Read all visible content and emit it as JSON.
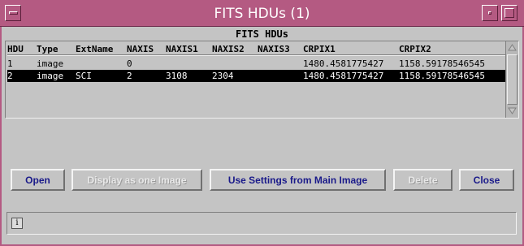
{
  "window": {
    "title": "FITS HDUs (1)"
  },
  "panel": {
    "title": "FITS HDUs"
  },
  "table": {
    "columns": [
      "HDU",
      "Type",
      "ExtName",
      "NAXIS",
      "NAXIS1",
      "NAXIS2",
      "NAXIS3",
      "CRPIX1",
      "CRPIX2"
    ],
    "rows": [
      [
        "1",
        "image",
        "",
        "0",
        "",
        "",
        "",
        "1480.4581775427",
        "1158.59178546545"
      ],
      [
        "2",
        "image",
        "SCI",
        "2",
        "3108",
        "2304",
        "",
        "1480.4581775427",
        "1158.59178546545"
      ]
    ],
    "selected_row": 2
  },
  "buttons": {
    "open": "Open",
    "display_one": "Display as one Image",
    "use_settings": "Use Settings from Main Image",
    "delete": "Delete",
    "close": "Close"
  },
  "status": {
    "icon": "info-icon",
    "glyph": "i"
  },
  "colors": {
    "titlebar": "#b45a82",
    "background": "#c4c4c4",
    "selected_row": "#000000",
    "button_text": "#1a1a8a"
  }
}
